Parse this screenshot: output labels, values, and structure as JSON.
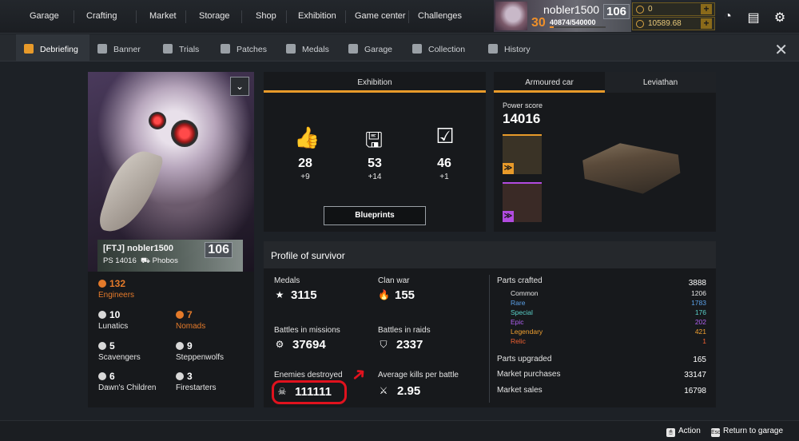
{
  "top_nav": [
    "Garage",
    "Crafting",
    "Market",
    "Storage",
    "Shop",
    "Exhibition",
    "Game center",
    "Challenges"
  ],
  "player": {
    "name": "nobler1500",
    "level": "106",
    "rank": "30",
    "xp": "40874/540000",
    "xp_fraction": 0.076
  },
  "currency": {
    "coins": "0",
    "credits": "10589.68",
    "plus": "+"
  },
  "top_icons": [
    "speedometer-icon",
    "chat-icon",
    "gear-icon"
  ],
  "sub_tabs": [
    "Debriefing",
    "Banner",
    "Trials",
    "Patches",
    "Medals",
    "Garage",
    "Collection",
    "History"
  ],
  "close_glyph": "✕",
  "profile": {
    "banner_name": "[FTJ] nobler1500",
    "ps": "PS 14016",
    "vehicle": "Phobos",
    "level": "106",
    "dropdown": "⌄"
  },
  "factions": [
    {
      "value": "132",
      "label": "Engineers",
      "highlight": true
    },
    {
      "value": "10",
      "label": "Lunatics",
      "highlight": false
    },
    {
      "value": "7",
      "label": "Nomads",
      "highlight": true
    },
    {
      "value": "5",
      "label": "Scavengers",
      "highlight": false
    },
    {
      "value": "9",
      "label": "Steppenwolfs",
      "highlight": false
    },
    {
      "value": "6",
      "label": "Dawn's Children",
      "highlight": false
    },
    {
      "value": "3",
      "label": "Firestarters",
      "highlight": false
    }
  ],
  "exhibition": {
    "tab": "Exhibition",
    "stats": [
      {
        "icon": "thumbs-up-icon",
        "value": "28",
        "delta": "+9"
      },
      {
        "icon": "save-icon",
        "value": "53",
        "delta": "+14"
      },
      {
        "icon": "user-check-icon",
        "value": "46",
        "delta": "+1"
      }
    ],
    "button": "Blueprints"
  },
  "car": {
    "tabs": [
      "Armoured car",
      "Leviathan"
    ],
    "power_label": "Power score",
    "power_value": "14016",
    "parts": [
      {
        "color": "#e89a2a",
        "tag": "≫"
      },
      {
        "color": "#b24be0",
        "tag": "≫"
      }
    ]
  },
  "survivor": {
    "title": "Profile of survivor",
    "stats": [
      {
        "label": "Medals",
        "value": "3115",
        "icon": "medal-icon",
        "glyph": "★"
      },
      {
        "label": "Clan war",
        "value": "155",
        "icon": "fire-icon",
        "glyph": "🔥"
      },
      {
        "label": "Battles in missions",
        "value": "37694",
        "icon": "mission-icon",
        "glyph": "⚙"
      },
      {
        "label": "Battles in raids",
        "value": "2337",
        "icon": "raid-icon",
        "glyph": "⛉"
      },
      {
        "label": "Enemies destroyed",
        "value": "111111",
        "icon": "skull-icon",
        "glyph": "☠"
      },
      {
        "label": "Average kills per battle",
        "value": "2.95",
        "icon": "kills-icon",
        "glyph": "⚔"
      }
    ],
    "parts_crafted": {
      "label": "Parts crafted",
      "value": "3888"
    },
    "rarities": [
      {
        "label": "Common",
        "value": "1206",
        "color": "#e4e4e4"
      },
      {
        "label": "Rare",
        "value": "1783",
        "color": "#5aa0e8"
      },
      {
        "label": "Special",
        "value": "176",
        "color": "#5ad0c8"
      },
      {
        "label": "Epic",
        "value": "202",
        "color": "#b060f0"
      },
      {
        "label": "Legendary",
        "value": "421",
        "color": "#f0a030"
      },
      {
        "label": "Relic",
        "value": "1",
        "color": "#f06030"
      }
    ],
    "other": [
      {
        "label": "Parts upgraded",
        "value": "165"
      },
      {
        "label": "Market purchases",
        "value": "33147"
      },
      {
        "label": "Market sales",
        "value": "16798"
      }
    ]
  },
  "bottom": {
    "action": "Action",
    "action_key": "🖱",
    "return": "Return to garage",
    "return_key": "Esc"
  },
  "colors": {
    "accent": "#e89a2a",
    "highlight_red": "#e0121e"
  }
}
